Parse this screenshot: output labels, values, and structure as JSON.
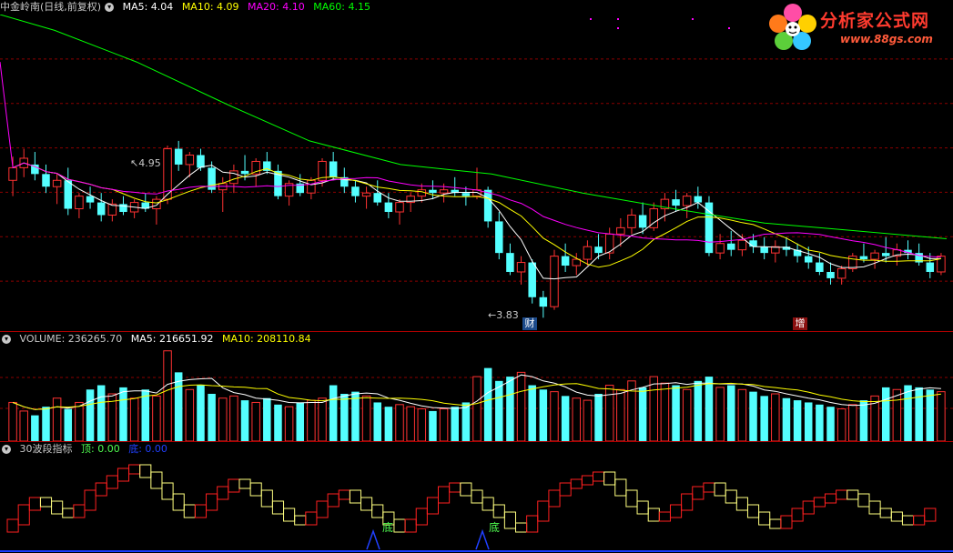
{
  "price_panel": {
    "title": "中金岭南(日线,前复权)",
    "ma5": "MA5: 4.04",
    "ma10": "MA10: 4.09",
    "ma20": "MA20: 4.10",
    "ma60": "MA60: 4.15",
    "high_label": "4.95",
    "low_label": "3.83",
    "marker_cai": "财",
    "marker_zeng": "增"
  },
  "volume_panel": {
    "volume": "VOLUME: 236265.70",
    "ma5": "MA5: 216651.92",
    "ma10": "MA10: 208110.84"
  },
  "wave_panel": {
    "title": "30波段指标",
    "ding": "顶: 0.00",
    "di": "底: 0.00",
    "bottom_label_1": "底",
    "bottom_label_2": "底"
  },
  "logo": {
    "name": "分析家公式网",
    "url": "www.88gs.com"
  },
  "colors": {
    "up": "#ff3232",
    "down": "#54ffff",
    "ma5": "#ffffff",
    "ma10": "#ffff00",
    "ma20": "#ff00ff",
    "ma60": "#00ff00",
    "grid": "#8b0000",
    "wave_up": "#ff2020",
    "wave_down": "#ffff80"
  },
  "chart_data": [
    {
      "type": "candlestick",
      "title": "中金岭南(日线,前复权)",
      "ylim": [
        3.78,
        5.75
      ],
      "annotations": [
        {
          "label": "4.95",
          "value": 4.95
        },
        {
          "label": "3.83",
          "value": 3.83
        }
      ],
      "ohlc": [
        [
          4.7,
          4.85,
          4.6,
          4.78
        ],
        [
          4.78,
          4.9,
          4.72,
          4.84
        ],
        [
          4.8,
          4.88,
          4.7,
          4.74
        ],
        [
          4.74,
          4.8,
          4.62,
          4.66
        ],
        [
          4.66,
          4.74,
          4.55,
          4.7
        ],
        [
          4.7,
          4.78,
          4.48,
          4.52
        ],
        [
          4.52,
          4.62,
          4.46,
          4.6
        ],
        [
          4.6,
          4.66,
          4.52,
          4.56
        ],
        [
          4.56,
          4.62,
          4.44,
          4.48
        ],
        [
          4.48,
          4.58,
          4.44,
          4.55
        ],
        [
          4.55,
          4.6,
          4.48,
          4.5
        ],
        [
          4.5,
          4.58,
          4.46,
          4.56
        ],
        [
          4.56,
          4.62,
          4.5,
          4.52
        ],
        [
          4.52,
          4.6,
          4.42,
          4.58
        ],
        [
          4.58,
          4.92,
          4.55,
          4.9
        ],
        [
          4.9,
          4.95,
          4.76,
          4.8
        ],
        [
          4.8,
          4.88,
          4.72,
          4.86
        ],
        [
          4.86,
          4.9,
          4.76,
          4.78
        ],
        [
          4.78,
          4.82,
          4.62,
          4.64
        ],
        [
          4.64,
          4.72,
          4.5,
          4.68
        ],
        [
          4.68,
          4.8,
          4.62,
          4.76
        ],
        [
          4.76,
          4.86,
          4.7,
          4.74
        ],
        [
          4.74,
          4.84,
          4.66,
          4.82
        ],
        [
          4.82,
          4.88,
          4.74,
          4.76
        ],
        [
          4.76,
          4.8,
          4.58,
          4.6
        ],
        [
          4.6,
          4.7,
          4.54,
          4.68
        ],
        [
          4.68,
          4.74,
          4.6,
          4.62
        ],
        [
          4.62,
          4.72,
          4.58,
          4.7
        ],
        [
          4.7,
          4.84,
          4.66,
          4.82
        ],
        [
          4.82,
          4.88,
          4.7,
          4.72
        ],
        [
          4.72,
          4.78,
          4.62,
          4.66
        ],
        [
          4.66,
          4.7,
          4.56,
          4.6
        ],
        [
          4.6,
          4.66,
          4.52,
          4.62
        ],
        [
          4.62,
          4.7,
          4.54,
          4.56
        ],
        [
          4.56,
          4.62,
          4.46,
          4.5
        ],
        [
          4.5,
          4.58,
          4.42,
          4.56
        ],
        [
          4.56,
          4.62,
          4.5,
          4.6
        ],
        [
          4.6,
          4.68,
          4.56,
          4.64
        ],
        [
          4.64,
          4.7,
          4.58,
          4.62
        ],
        [
          4.62,
          4.68,
          4.56,
          4.64
        ],
        [
          4.64,
          4.72,
          4.6,
          4.62
        ],
        [
          4.62,
          4.66,
          4.54,
          4.6
        ],
        [
          4.6,
          4.78,
          4.58,
          4.64
        ],
        [
          4.64,
          4.66,
          4.4,
          4.44
        ],
        [
          4.44,
          4.5,
          4.2,
          4.24
        ],
        [
          4.24,
          4.3,
          4.1,
          4.12
        ],
        [
          4.12,
          4.22,
          4.04,
          4.18
        ],
        [
          4.18,
          4.2,
          3.92,
          3.96
        ],
        [
          3.96,
          4.0,
          3.83,
          3.9
        ],
        [
          3.9,
          4.26,
          3.88,
          4.22
        ],
        [
          4.22,
          4.3,
          4.12,
          4.16
        ],
        [
          4.16,
          4.24,
          4.1,
          4.2
        ],
        [
          4.2,
          4.32,
          4.16,
          4.28
        ],
        [
          4.28,
          4.36,
          4.2,
          4.24
        ],
        [
          4.24,
          4.4,
          4.2,
          4.36
        ],
        [
          4.36,
          4.46,
          4.28,
          4.4
        ],
        [
          4.4,
          4.52,
          4.36,
          4.48
        ],
        [
          4.48,
          4.56,
          4.36,
          4.4
        ],
        [
          4.4,
          4.56,
          4.38,
          4.52
        ],
        [
          4.52,
          4.62,
          4.44,
          4.58
        ],
        [
          4.58,
          4.64,
          4.5,
          4.54
        ],
        [
          4.54,
          4.62,
          4.46,
          4.6
        ],
        [
          4.6,
          4.66,
          4.52,
          4.56
        ],
        [
          4.56,
          4.6,
          4.22,
          4.24
        ],
        [
          4.24,
          4.36,
          4.2,
          4.3
        ],
        [
          4.3,
          4.38,
          4.22,
          4.26
        ],
        [
          4.26,
          4.36,
          4.22,
          4.32
        ],
        [
          4.32,
          4.36,
          4.24,
          4.28
        ],
        [
          4.28,
          4.34,
          4.2,
          4.24
        ],
        [
          4.24,
          4.32,
          4.18,
          4.28
        ],
        [
          4.28,
          4.34,
          4.22,
          4.26
        ],
        [
          4.26,
          4.3,
          4.18,
          4.22
        ],
        [
          4.22,
          4.28,
          4.14,
          4.18
        ],
        [
          4.18,
          4.24,
          4.1,
          4.12
        ],
        [
          4.12,
          4.18,
          4.04,
          4.08
        ],
        [
          4.08,
          4.16,
          4.04,
          4.14
        ],
        [
          4.14,
          4.24,
          4.12,
          4.22
        ],
        [
          4.22,
          4.3,
          4.18,
          4.2
        ],
        [
          4.2,
          4.26,
          4.14,
          4.24
        ],
        [
          4.24,
          4.34,
          4.18,
          4.22
        ],
        [
          4.22,
          4.3,
          4.16,
          4.26
        ],
        [
          4.26,
          4.32,
          4.2,
          4.24
        ],
        [
          4.24,
          4.3,
          4.16,
          4.18
        ],
        [
          4.18,
          4.24,
          4.08,
          4.12
        ],
        [
          4.12,
          4.24,
          4.1,
          4.22
        ]
      ]
    },
    {
      "type": "bar",
      "title": "VOLUME",
      "ylim": [
        0,
        440000
      ],
      "values": [
        180,
        140,
        120,
        160,
        200,
        150,
        180,
        240,
        260,
        220,
        250,
        200,
        240,
        210,
        420,
        320,
        240,
        260,
        220,
        200,
        210,
        190,
        180,
        200,
        170,
        160,
        180,
        190,
        200,
        260,
        220,
        230,
        210,
        180,
        160,
        170,
        160,
        150,
        140,
        150,
        160,
        180,
        300,
        340,
        280,
        300,
        320,
        260,
        240,
        230,
        210,
        200,
        190,
        220,
        260,
        240,
        280,
        250,
        300,
        270,
        260,
        240,
        280,
        300,
        250,
        260,
        240,
        230,
        210,
        220,
        200,
        190,
        180,
        170,
        160,
        150,
        170,
        190,
        210,
        250,
        240,
        260,
        250,
        240,
        230
      ],
      "ma_labels": [
        "MA5: 216651.92",
        "MA10: 208110.84"
      ]
    },
    {
      "type": "line",
      "title": "30波段指标",
      "ylim": [
        0,
        100
      ],
      "values": [
        10,
        20,
        40,
        50,
        45,
        35,
        30,
        40,
        60,
        70,
        80,
        90,
        95,
        85,
        70,
        55,
        40,
        30,
        40,
        55,
        65,
        75,
        70,
        60,
        45,
        35,
        25,
        20,
        30,
        45,
        55,
        60,
        50,
        40,
        30,
        20,
        10,
        20,
        35,
        50,
        65,
        70,
        60,
        50,
        40,
        30,
        15,
        10,
        25,
        45,
        60,
        70,
        75,
        80,
        85,
        75,
        60,
        45,
        35,
        25,
        30,
        40,
        55,
        65,
        70,
        60,
        50,
        40,
        30,
        20,
        15,
        25,
        35,
        45,
        50,
        55,
        60,
        55,
        45,
        35,
        30,
        25,
        20,
        25,
        35
      ]
    }
  ]
}
